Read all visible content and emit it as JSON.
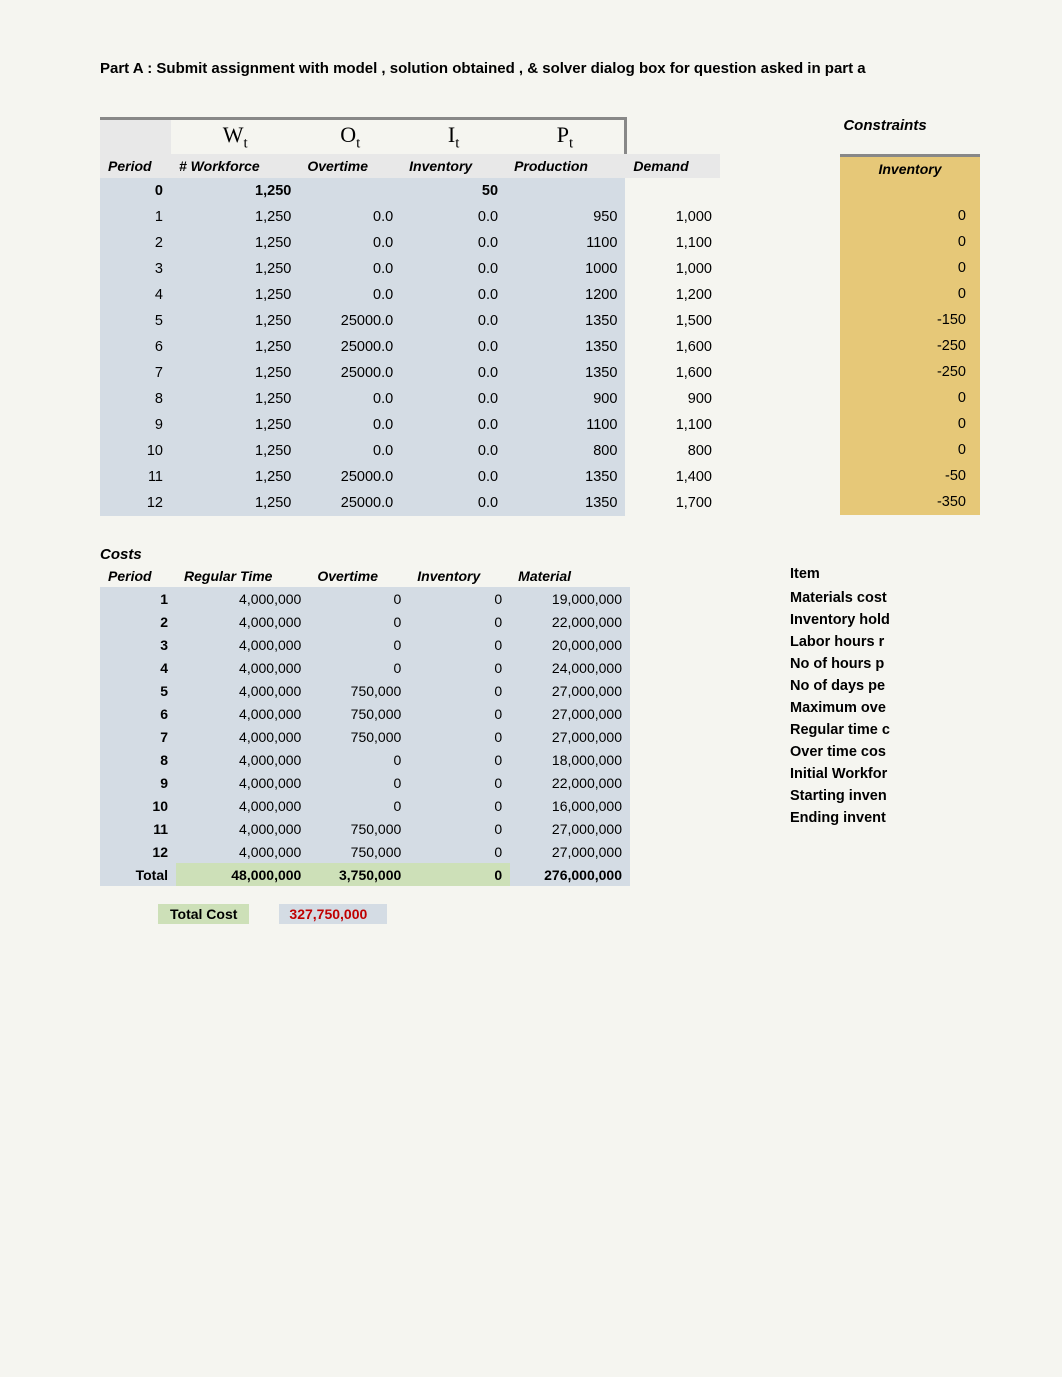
{
  "title": "Part A : Submit assignment  with model , solution obtained , & solver dialog box for  question asked in part a",
  "variable_headers": [
    "Wₜ",
    "Oₜ",
    "Iₜ",
    "Pₜ"
  ],
  "main_headers": [
    "Period",
    "# Workforce",
    "Overtime",
    "Inventory",
    "Production",
    "Demand"
  ],
  "constraints_title": "Constraints",
  "inventory_header": "Inventory",
  "row0": {
    "period": "0",
    "workforce": "1,250",
    "inventory": "50"
  },
  "main_rows": [
    {
      "p": "1",
      "w": "1,250",
      "o": "0.0",
      "i": "0.0",
      "pr": "950",
      "d": "1,000",
      "inv": "0"
    },
    {
      "p": "2",
      "w": "1,250",
      "o": "0.0",
      "i": "0.0",
      "pr": "1100",
      "d": "1,100",
      "inv": "0"
    },
    {
      "p": "3",
      "w": "1,250",
      "o": "0.0",
      "i": "0.0",
      "pr": "1000",
      "d": "1,000",
      "inv": "0"
    },
    {
      "p": "4",
      "w": "1,250",
      "o": "0.0",
      "i": "0.0",
      "pr": "1200",
      "d": "1,200",
      "inv": "0"
    },
    {
      "p": "5",
      "w": "1,250",
      "o": "25000.0",
      "i": "0.0",
      "pr": "1350",
      "d": "1,500",
      "inv": "-150"
    },
    {
      "p": "6",
      "w": "1,250",
      "o": "25000.0",
      "i": "0.0",
      "pr": "1350",
      "d": "1,600",
      "inv": "-250"
    },
    {
      "p": "7",
      "w": "1,250",
      "o": "25000.0",
      "i": "0.0",
      "pr": "1350",
      "d": "1,600",
      "inv": "-250"
    },
    {
      "p": "8",
      "w": "1,250",
      "o": "0.0",
      "i": "0.0",
      "pr": "900",
      "d": "900",
      "inv": "0"
    },
    {
      "p": "9",
      "w": "1,250",
      "o": "0.0",
      "i": "0.0",
      "pr": "1100",
      "d": "1,100",
      "inv": "0"
    },
    {
      "p": "10",
      "w": "1,250",
      "o": "0.0",
      "i": "0.0",
      "pr": "800",
      "d": "800",
      "inv": "0"
    },
    {
      "p": "11",
      "w": "1,250",
      "o": "25000.0",
      "i": "0.0",
      "pr": "1350",
      "d": "1,400",
      "inv": "-50"
    },
    {
      "p": "12",
      "w": "1,250",
      "o": "25000.0",
      "i": "0.0",
      "pr": "1350",
      "d": "1,700",
      "inv": "-350"
    }
  ],
  "costs_title": "Costs",
  "cost_headers": [
    "Period",
    "Regular Time",
    "Overtime",
    "Inventory",
    "Material"
  ],
  "cost_rows": [
    {
      "p": "1",
      "r": "4,000,000",
      "o": "0",
      "i": "0",
      "m": "19,000,000"
    },
    {
      "p": "2",
      "r": "4,000,000",
      "o": "0",
      "i": "0",
      "m": "22,000,000"
    },
    {
      "p": "3",
      "r": "4,000,000",
      "o": "0",
      "i": "0",
      "m": "20,000,000"
    },
    {
      "p": "4",
      "r": "4,000,000",
      "o": "0",
      "i": "0",
      "m": "24,000,000"
    },
    {
      "p": "5",
      "r": "4,000,000",
      "o": "750,000",
      "i": "0",
      "m": "27,000,000"
    },
    {
      "p": "6",
      "r": "4,000,000",
      "o": "750,000",
      "i": "0",
      "m": "27,000,000"
    },
    {
      "p": "7",
      "r": "4,000,000",
      "o": "750,000",
      "i": "0",
      "m": "27,000,000"
    },
    {
      "p": "8",
      "r": "4,000,000",
      "o": "0",
      "i": "0",
      "m": "18,000,000"
    },
    {
      "p": "9",
      "r": "4,000,000",
      "o": "0",
      "i": "0",
      "m": "22,000,000"
    },
    {
      "p": "10",
      "r": "4,000,000",
      "o": "0",
      "i": "0",
      "m": "16,000,000"
    },
    {
      "p": "11",
      "r": "4,000,000",
      "o": "750,000",
      "i": "0",
      "m": "27,000,000"
    },
    {
      "p": "12",
      "r": "4,000,000",
      "o": "750,000",
      "i": "0",
      "m": "27,000,000"
    }
  ],
  "cost_total": {
    "p": "Total",
    "r": "48,000,000",
    "o": "3,750,000",
    "i": "0",
    "m": "276,000,000"
  },
  "total_cost_label": "Total Cost",
  "total_cost_value": "327,750,000",
  "items_header": "Item",
  "items": [
    "Materials cost",
    "Inventory hold",
    "Labor hours r",
    "No of hours p",
    "No of days pe",
    "Maximum ove",
    "Regular time c",
    "Over time cos",
    "Initial Workfor",
    "Starting inven",
    "Ending invent"
  ],
  "chart_data": {
    "type": "table",
    "tables": [
      {
        "name": "Production Plan",
        "columns": [
          "Period",
          "# Workforce",
          "Overtime",
          "Inventory",
          "Production",
          "Demand"
        ],
        "rows": [
          [
            0,
            1250,
            null,
            50,
            null,
            null
          ],
          [
            1,
            1250,
            0.0,
            0.0,
            950,
            1000
          ],
          [
            2,
            1250,
            0.0,
            0.0,
            1100,
            1100
          ],
          [
            3,
            1250,
            0.0,
            0.0,
            1000,
            1000
          ],
          [
            4,
            1250,
            0.0,
            0.0,
            1200,
            1200
          ],
          [
            5,
            1250,
            25000.0,
            0.0,
            1350,
            1500
          ],
          [
            6,
            1250,
            25000.0,
            0.0,
            1350,
            1600
          ],
          [
            7,
            1250,
            25000.0,
            0.0,
            1350,
            1600
          ],
          [
            8,
            1250,
            0.0,
            0.0,
            900,
            900
          ],
          [
            9,
            1250,
            0.0,
            0.0,
            1100,
            1100
          ],
          [
            10,
            1250,
            0.0,
            0.0,
            800,
            800
          ],
          [
            11,
            1250,
            25000.0,
            0.0,
            1350,
            1400
          ],
          [
            12,
            1250,
            25000.0,
            0.0,
            1350,
            1700
          ]
        ]
      },
      {
        "name": "Inventory Constraint",
        "columns": [
          "Period",
          "Inventory"
        ],
        "rows": [
          [
            1,
            0
          ],
          [
            2,
            0
          ],
          [
            3,
            0
          ],
          [
            4,
            0
          ],
          [
            5,
            -150
          ],
          [
            6,
            -250
          ],
          [
            7,
            -250
          ],
          [
            8,
            0
          ],
          [
            9,
            0
          ],
          [
            10,
            0
          ],
          [
            11,
            -50
          ],
          [
            12,
            -350
          ]
        ]
      },
      {
        "name": "Costs",
        "columns": [
          "Period",
          "Regular Time",
          "Overtime",
          "Inventory",
          "Material"
        ],
        "rows": [
          [
            1,
            4000000,
            0,
            0,
            19000000
          ],
          [
            2,
            4000000,
            0,
            0,
            22000000
          ],
          [
            3,
            4000000,
            0,
            0,
            20000000
          ],
          [
            4,
            4000000,
            0,
            0,
            24000000
          ],
          [
            5,
            4000000,
            750000,
            0,
            27000000
          ],
          [
            6,
            4000000,
            750000,
            0,
            27000000
          ],
          [
            7,
            4000000,
            750000,
            0,
            27000000
          ],
          [
            8,
            4000000,
            0,
            0,
            18000000
          ],
          [
            9,
            4000000,
            0,
            0,
            22000000
          ],
          [
            10,
            4000000,
            0,
            0,
            16000000
          ],
          [
            11,
            4000000,
            750000,
            0,
            27000000
          ],
          [
            12,
            4000000,
            750000,
            0,
            27000000
          ],
          [
            "Total",
            48000000,
            3750000,
            0,
            276000000
          ]
        ],
        "total_cost": 327750000
      }
    ]
  }
}
